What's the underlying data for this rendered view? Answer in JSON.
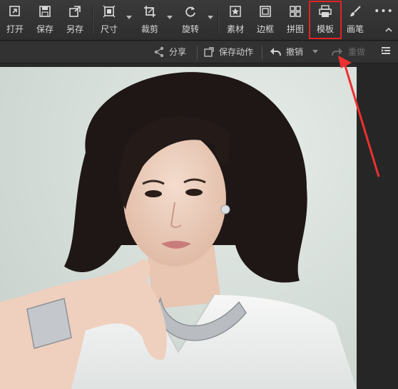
{
  "toolbar": {
    "open": "打开",
    "save": "保存",
    "save_as": "另存",
    "size": "尺寸",
    "crop": "裁剪",
    "rotate": "旋转",
    "material": "素材",
    "border": "边框",
    "collage": "拼图",
    "template": "模板",
    "brush": "画笔"
  },
  "actionbar": {
    "share": "分享",
    "save_action": "保存动作",
    "undo": "撤销",
    "redo": "重做"
  },
  "colors": {
    "highlight": "#e02424",
    "annotation_arrow": "#ee3030"
  }
}
